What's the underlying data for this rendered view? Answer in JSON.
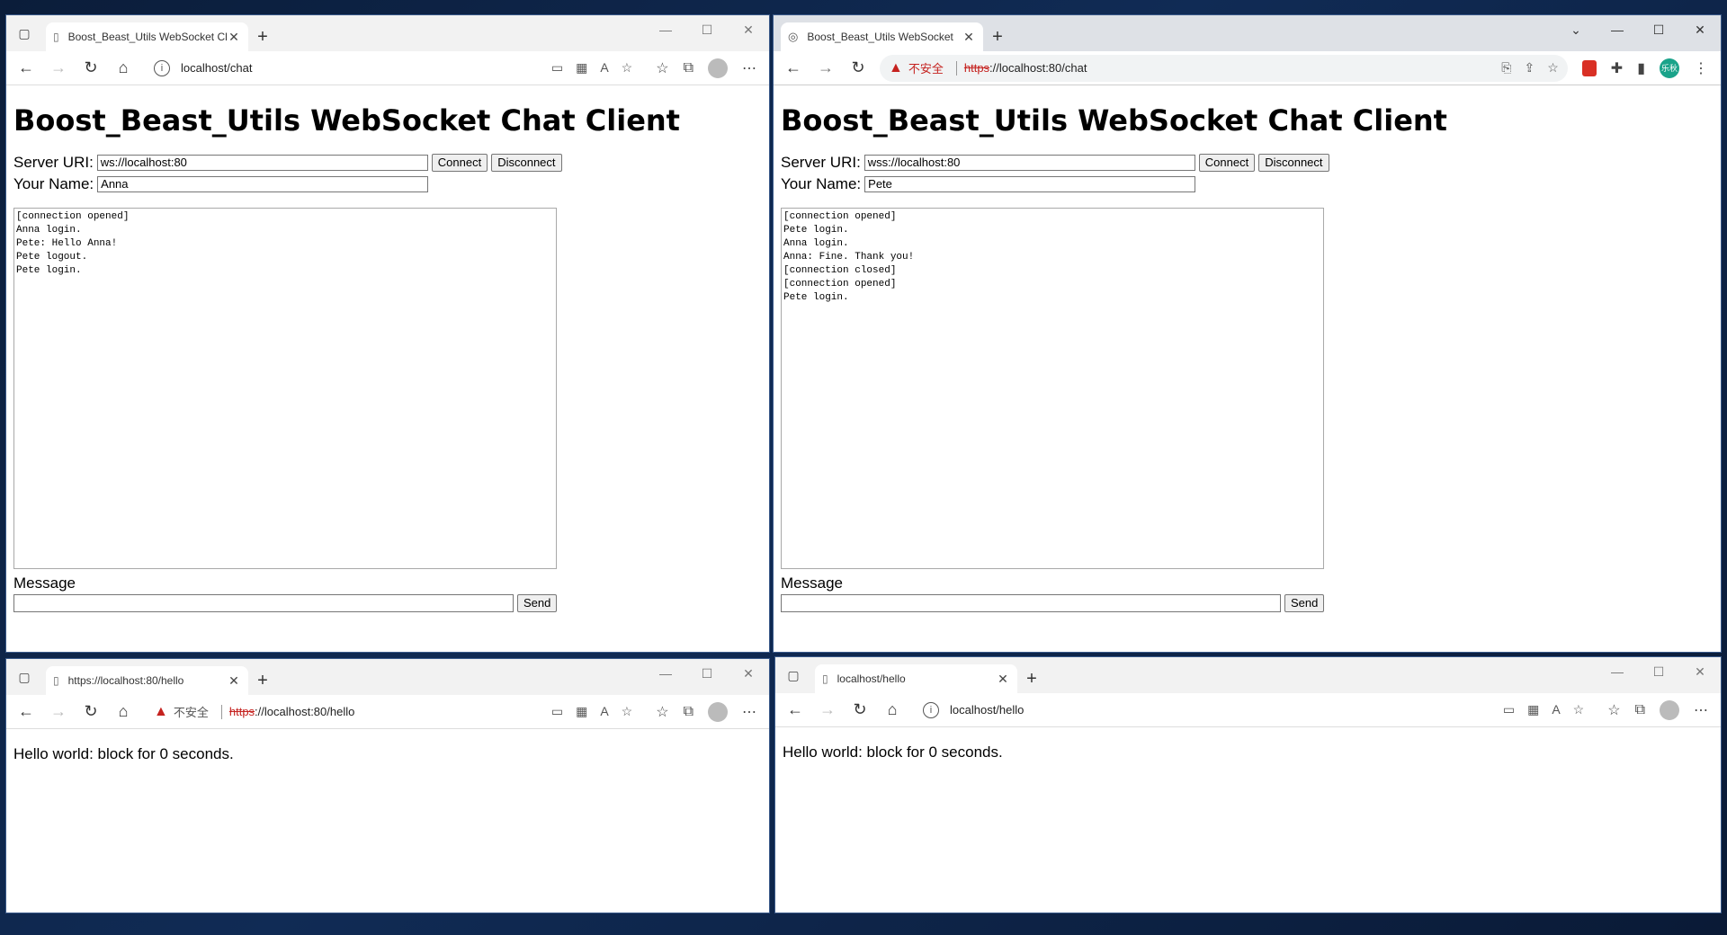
{
  "top_left": {
    "tab_title": "Boost_Beast_Utils WebSocket Ch",
    "address": "localhost/chat",
    "heading": "Boost_Beast_Utils WebSocket Chat Client",
    "server_uri_label": "Server URI:",
    "server_uri_value": "ws://localhost:80",
    "connect_label": "Connect",
    "disconnect_label": "Disconnect",
    "name_label": "Your Name:",
    "name_value": "Anna",
    "log": "[connection opened]\nAnna login.\nPete: Hello Anna!\nPete logout.\nPete login.",
    "message_label": "Message",
    "message_value": "",
    "send_label": "Send"
  },
  "top_right": {
    "tab_title": "Boost_Beast_Utils WebSocket",
    "insecure_label": "不安全",
    "url_scheme": "https",
    "url_rest": "://localhost:80/chat",
    "avatar_text": "乐秋",
    "heading": "Boost_Beast_Utils WebSocket Chat Client",
    "server_uri_label": "Server URI:",
    "server_uri_value": "wss://localhost:80",
    "connect_label": "Connect",
    "disconnect_label": "Disconnect",
    "name_label": "Your Name:",
    "name_value": "Pete",
    "log": "[connection opened]\nPete login.\nAnna login.\nAnna: Fine. Thank you!\n[connection closed]\n[connection opened]\nPete login.",
    "message_label": "Message",
    "message_value": "",
    "send_label": "Send"
  },
  "bottom_left": {
    "tab_title": "https://localhost:80/hello",
    "insecure_label": "不安全",
    "url_scheme": "https",
    "url_rest": "://localhost:80/hello",
    "body_text": "Hello world: block for 0 seconds."
  },
  "bottom_right": {
    "tab_title": "localhost/hello",
    "address": "localhost/hello",
    "body_text": "Hello world: block for 0 seconds."
  }
}
